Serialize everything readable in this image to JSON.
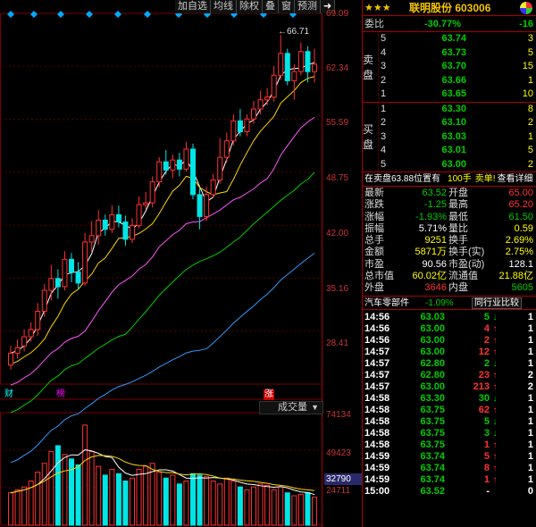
{
  "toolbar": [
    "加自选",
    "均线",
    "除权",
    "叠",
    "窗",
    "预测",
    "➜"
  ],
  "price_axis": [
    "69.09",
    "62.34",
    "55.59",
    "48.75",
    "42.00",
    "35.16",
    "28.41"
  ],
  "volume_axis": [
    "74134",
    "49423",
    "24711"
  ],
  "volume_current": "32790",
  "high_label": "66.71",
  "events": [
    "财",
    "榜",
    "涨"
  ],
  "volume_selector": "成交量",
  "colors": {
    "up": "#ff3333",
    "down": "#00e5e5",
    "ma5": "#ffffff",
    "ma10": "#ffd700",
    "ma20": "#ff55ff",
    "ma30": "#00cc00",
    "ma60": "#3399ff"
  },
  "chart_data": {
    "type": "candlestick",
    "ylim": [
      28.41,
      69.09
    ],
    "candles": [
      {
        "o": 30.5,
        "c": 31.8,
        "h": 32.6,
        "l": 30.0
      },
      {
        "o": 31.8,
        "c": 32.4,
        "h": 33.3,
        "l": 31.2
      },
      {
        "o": 32.6,
        "c": 33.6,
        "h": 34.4,
        "l": 32.0
      },
      {
        "o": 33.6,
        "c": 34.4,
        "h": 35.2,
        "l": 33.1
      },
      {
        "o": 34.4,
        "c": 36.4,
        "h": 37.3,
        "l": 33.7
      },
      {
        "o": 36.4,
        "c": 38.7,
        "h": 39.4,
        "l": 35.8
      },
      {
        "o": 38.7,
        "c": 40.0,
        "h": 41.5,
        "l": 37.6
      },
      {
        "o": 40.0,
        "c": 39.1,
        "h": 41.0,
        "l": 37.8
      },
      {
        "o": 39.1,
        "c": 42.1,
        "h": 43.0,
        "l": 38.7
      },
      {
        "o": 42.1,
        "c": 40.7,
        "h": 42.8,
        "l": 39.6
      },
      {
        "o": 40.7,
        "c": 39.5,
        "h": 41.8,
        "l": 38.8
      },
      {
        "o": 39.5,
        "c": 44.0,
        "h": 45.0,
        "l": 39.2
      },
      {
        "o": 44.0,
        "c": 44.7,
        "h": 46.3,
        "l": 42.9
      },
      {
        "o": 44.7,
        "c": 46.4,
        "h": 47.5,
        "l": 43.7
      },
      {
        "o": 46.4,
        "c": 45.4,
        "h": 47.0,
        "l": 44.7
      },
      {
        "o": 45.4,
        "c": 47.0,
        "h": 48.0,
        "l": 45.0
      },
      {
        "o": 47.0,
        "c": 46.2,
        "h": 48.0,
        "l": 45.6
      },
      {
        "o": 46.2,
        "c": 44.3,
        "h": 46.9,
        "l": 43.6
      },
      {
        "o": 44.3,
        "c": 45.8,
        "h": 46.6,
        "l": 43.9
      },
      {
        "o": 45.8,
        "c": 48.1,
        "h": 49.0,
        "l": 45.5
      },
      {
        "o": 48.1,
        "c": 48.3,
        "h": 49.5,
        "l": 47.6
      },
      {
        "o": 48.3,
        "c": 50.6,
        "h": 51.2,
        "l": 47.8
      },
      {
        "o": 50.6,
        "c": 52.8,
        "h": 53.3,
        "l": 50.0
      },
      {
        "o": 52.8,
        "c": 51.9,
        "h": 54.1,
        "l": 51.4
      },
      {
        "o": 51.9,
        "c": 53.0,
        "h": 53.6,
        "l": 51.0
      },
      {
        "o": 53.0,
        "c": 52.0,
        "h": 53.8,
        "l": 51.2
      },
      {
        "o": 52.0,
        "c": 54.2,
        "h": 55.0,
        "l": 51.7
      },
      {
        "o": 54.2,
        "c": 49.2,
        "h": 54.8,
        "l": 48.7
      },
      {
        "o": 49.2,
        "c": 46.8,
        "h": 49.9,
        "l": 45.4
      },
      {
        "o": 46.8,
        "c": 49.2,
        "h": 50.1,
        "l": 46.3
      },
      {
        "o": 49.2,
        "c": 50.8,
        "h": 51.5,
        "l": 48.9
      },
      {
        "o": 50.8,
        "c": 53.3,
        "h": 55.4,
        "l": 50.4
      },
      {
        "o": 53.3,
        "c": 55.1,
        "h": 56.0,
        "l": 52.7
      },
      {
        "o": 55.1,
        "c": 57.3,
        "h": 58.0,
        "l": 54.6
      },
      {
        "o": 57.3,
        "c": 56.1,
        "h": 58.6,
        "l": 55.6
      },
      {
        "o": 56.1,
        "c": 57.5,
        "h": 58.0,
        "l": 55.6
      },
      {
        "o": 57.5,
        "c": 58.6,
        "h": 59.5,
        "l": 57.0
      },
      {
        "o": 58.6,
        "c": 59.6,
        "h": 60.6,
        "l": 58.0
      },
      {
        "o": 59.6,
        "c": 59.9,
        "h": 60.9,
        "l": 59.0
      },
      {
        "o": 59.9,
        "c": 62.3,
        "h": 63.3,
        "l": 59.4
      },
      {
        "o": 62.3,
        "c": 64.7,
        "h": 66.71,
        "l": 61.8
      },
      {
        "o": 64.7,
        "c": 61.7,
        "h": 65.2,
        "l": 61.2
      },
      {
        "o": 61.7,
        "c": 62.7,
        "h": 63.5,
        "l": 59.6
      },
      {
        "o": 62.7,
        "c": 64.9,
        "h": 65.9,
        "l": 62.3
      },
      {
        "o": 64.9,
        "c": 62.7,
        "h": 65.5,
        "l": 61.5
      },
      {
        "o": 62.7,
        "c": 63.52,
        "h": 65.2,
        "l": 61.5
      }
    ],
    "volume": [
      22,
      24,
      26,
      30,
      36,
      42,
      50,
      54,
      48,
      45,
      41,
      68,
      50,
      40,
      34,
      38,
      35,
      30,
      32,
      38,
      40,
      42,
      36,
      32,
      34,
      28,
      30,
      35,
      34,
      33,
      30,
      28,
      32,
      30,
      26,
      24,
      26,
      28,
      27,
      24,
      26,
      22,
      20,
      21,
      22,
      19
    ],
    "volume_max": 74134
  },
  "quote": {
    "stars": "★★★",
    "name": "联明股份 603006",
    "webi_label": "委比",
    "webi_pct": "-30.77%",
    "webi_diff": "-16",
    "sell_label": "卖盘",
    "buy_label": "买盘",
    "sell": [
      {
        "n": "5",
        "p": "63.74",
        "v": "3"
      },
      {
        "n": "4",
        "p": "63.73",
        "v": "5"
      },
      {
        "n": "3",
        "p": "63.70",
        "v": "15"
      },
      {
        "n": "2",
        "p": "63.66",
        "v": "1"
      },
      {
        "n": "1",
        "p": "63.65",
        "v": "10"
      }
    ],
    "buy": [
      {
        "n": "1",
        "p": "63.30",
        "v": "8"
      },
      {
        "n": "2",
        "p": "63.10",
        "v": "2"
      },
      {
        "n": "3",
        "p": "63.03",
        "v": "1"
      },
      {
        "n": "4",
        "p": "63.01",
        "v": "5"
      },
      {
        "n": "5",
        "p": "63.00",
        "v": "2"
      }
    ],
    "pending": {
      "a": "在卖盘63.88位置有",
      "b": "100手",
      "c": "卖单!",
      "d": "查看详细"
    },
    "stats": [
      {
        "k": "最新",
        "v": "63.52",
        "vc": "green",
        "k2": "开盘",
        "v2": "65.00",
        "v2c": "red"
      },
      {
        "k": "涨跌",
        "v": "-1.25",
        "vc": "green",
        "k2": "最高",
        "v2": "65.20",
        "v2c": "red"
      },
      {
        "k": "涨幅",
        "v": "-1.93%",
        "vc": "green",
        "k2": "最低",
        "v2": "61.50",
        "v2c": "green"
      },
      {
        "k": "振幅",
        "v": "5.71%",
        "vc": "white",
        "k2": "量比",
        "v2": "0.59",
        "v2c": "yellow"
      },
      {
        "k": "总手",
        "v": "9251",
        "vc": "yellow",
        "k2": "换手",
        "v2": "2.69%",
        "v2c": "yellow"
      },
      {
        "k": "金额",
        "v": "5871万",
        "vc": "yellow",
        "k2": "换手(实)",
        "v2": "2.75%",
        "v2c": "yellow"
      },
      {
        "k": "市盈",
        "v": "90.56",
        "vc": "white",
        "k2": "市盈(动)",
        "v2": "128.1",
        "v2c": "white"
      },
      {
        "k": "总市值",
        "v": "60.02亿",
        "vc": "yellow",
        "k2": "流通值",
        "v2": "21.88亿",
        "v2c": "yellow"
      },
      {
        "k": "外盘",
        "v": "3646",
        "vc": "red",
        "k2": "内盘",
        "v2": "5605",
        "v2c": "green"
      }
    ],
    "sector": {
      "name": "汽车零部件",
      "change": "-1.09%",
      "button": "同行业比较"
    },
    "ticks": [
      {
        "t": "14:56",
        "p": "63.03",
        "pc": "green",
        "v": "5",
        "vc": "green",
        "a": "↓",
        "ac": "green",
        "n": "1"
      },
      {
        "t": "14:56",
        "p": "63.00",
        "pc": "green",
        "v": "4",
        "vc": "red",
        "a": "↑",
        "ac": "red",
        "n": "1"
      },
      {
        "t": "14:56",
        "p": "63.00",
        "pc": "green",
        "v": "2",
        "vc": "red",
        "a": "↑",
        "ac": "red",
        "n": "1"
      },
      {
        "t": "14:57",
        "p": "63.00",
        "pc": "green",
        "v": "12",
        "vc": "red",
        "a": "↑",
        "ac": "red",
        "n": "1"
      },
      {
        "t": "14:57",
        "p": "62.80",
        "pc": "green",
        "v": "2",
        "vc": "green",
        "a": "↓",
        "ac": "green",
        "n": "1"
      },
      {
        "t": "14:57",
        "p": "62.80",
        "pc": "green",
        "v": "23",
        "vc": "red",
        "a": "↑",
        "ac": "red",
        "n": "2"
      },
      {
        "t": "14:57",
        "p": "63.00",
        "pc": "green",
        "v": "213",
        "vc": "red",
        "a": "↑",
        "ac": "red",
        "n": "2"
      },
      {
        "t": "14:58",
        "p": "63.30",
        "pc": "green",
        "v": "30",
        "vc": "green",
        "a": "↓",
        "ac": "green",
        "n": "1"
      },
      {
        "t": "14:58",
        "p": "63.75",
        "pc": "green",
        "v": "62",
        "vc": "red",
        "a": "↑",
        "ac": "red",
        "n": "1"
      },
      {
        "t": "14:58",
        "p": "63.75",
        "pc": "green",
        "v": "5",
        "vc": "green",
        "a": "↓",
        "ac": "green",
        "n": "1"
      },
      {
        "t": "14:58",
        "p": "63.75",
        "pc": "green",
        "v": "3",
        "vc": "green",
        "a": "↓",
        "ac": "green",
        "n": "1"
      },
      {
        "t": "14:58",
        "p": "63.75",
        "pc": "green",
        "v": "1",
        "vc": "red",
        "a": "↑",
        "ac": "red",
        "n": "1"
      },
      {
        "t": "14:59",
        "p": "63.74",
        "pc": "green",
        "v": "5",
        "vc": "red",
        "a": "↑",
        "ac": "red",
        "n": "1"
      },
      {
        "t": "14:59",
        "p": "63.74",
        "pc": "green",
        "v": "8",
        "vc": "red",
        "a": "↑",
        "ac": "red",
        "n": "1"
      },
      {
        "t": "14:59",
        "p": "63.74",
        "pc": "green",
        "v": "1",
        "vc": "red",
        "a": "↑",
        "ac": "red",
        "n": "1"
      },
      {
        "t": "15:00",
        "p": "63.52",
        "pc": "green",
        "v": "-",
        "vc": "white",
        "a": "",
        "ac": "white",
        "n": "0"
      }
    ]
  }
}
